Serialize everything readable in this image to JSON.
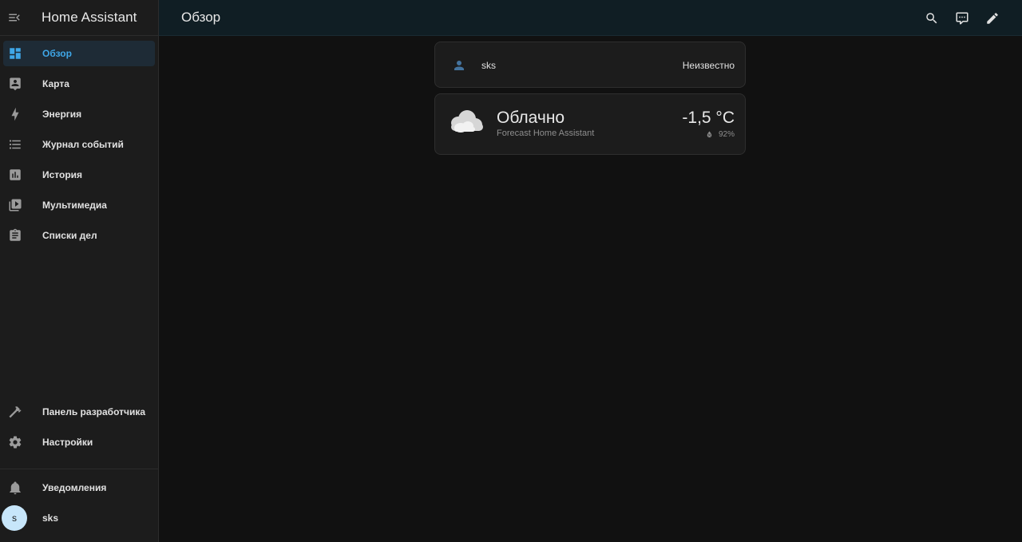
{
  "app": {
    "title": "Home Assistant"
  },
  "sidebar": {
    "items": [
      {
        "label": "Обзор",
        "icon": "dashboard-icon",
        "active": true
      },
      {
        "label": "Карта",
        "icon": "map-account-icon"
      },
      {
        "label": "Энергия",
        "icon": "lightning-bolt-icon"
      },
      {
        "label": "Журнал событий",
        "icon": "format-list-bulleted-icon"
      },
      {
        "label": "История",
        "icon": "chart-box-icon"
      },
      {
        "label": "Мультимедиа",
        "icon": "play-box-multiple-icon"
      },
      {
        "label": "Списки дел",
        "icon": "clipboard-list-icon"
      }
    ],
    "developer_tools": {
      "label": "Панель разработчика",
      "icon": "hammer-icon"
    },
    "settings": {
      "label": "Настройки",
      "icon": "cog-icon"
    },
    "notifications": {
      "label": "Уведомления",
      "icon": "bell-icon"
    },
    "user": {
      "name": "sks",
      "avatar_initial": "s"
    }
  },
  "topbar": {
    "page_title": "Обзор",
    "actions": [
      "search-icon",
      "assist-icon",
      "pencil-icon"
    ]
  },
  "cards": {
    "person": {
      "name": "sks",
      "state": "Неизвестно"
    },
    "weather": {
      "condition": "Облачно",
      "source": "Forecast Home Assistant",
      "temperature": "-1,5 °C",
      "humidity": "92%"
    }
  },
  "colors": {
    "accent": "#3fa7e8",
    "background": "#111111",
    "sidebar": "#1c1c1c",
    "topbar": "#101e24",
    "avatar": "#c7e6fa"
  }
}
